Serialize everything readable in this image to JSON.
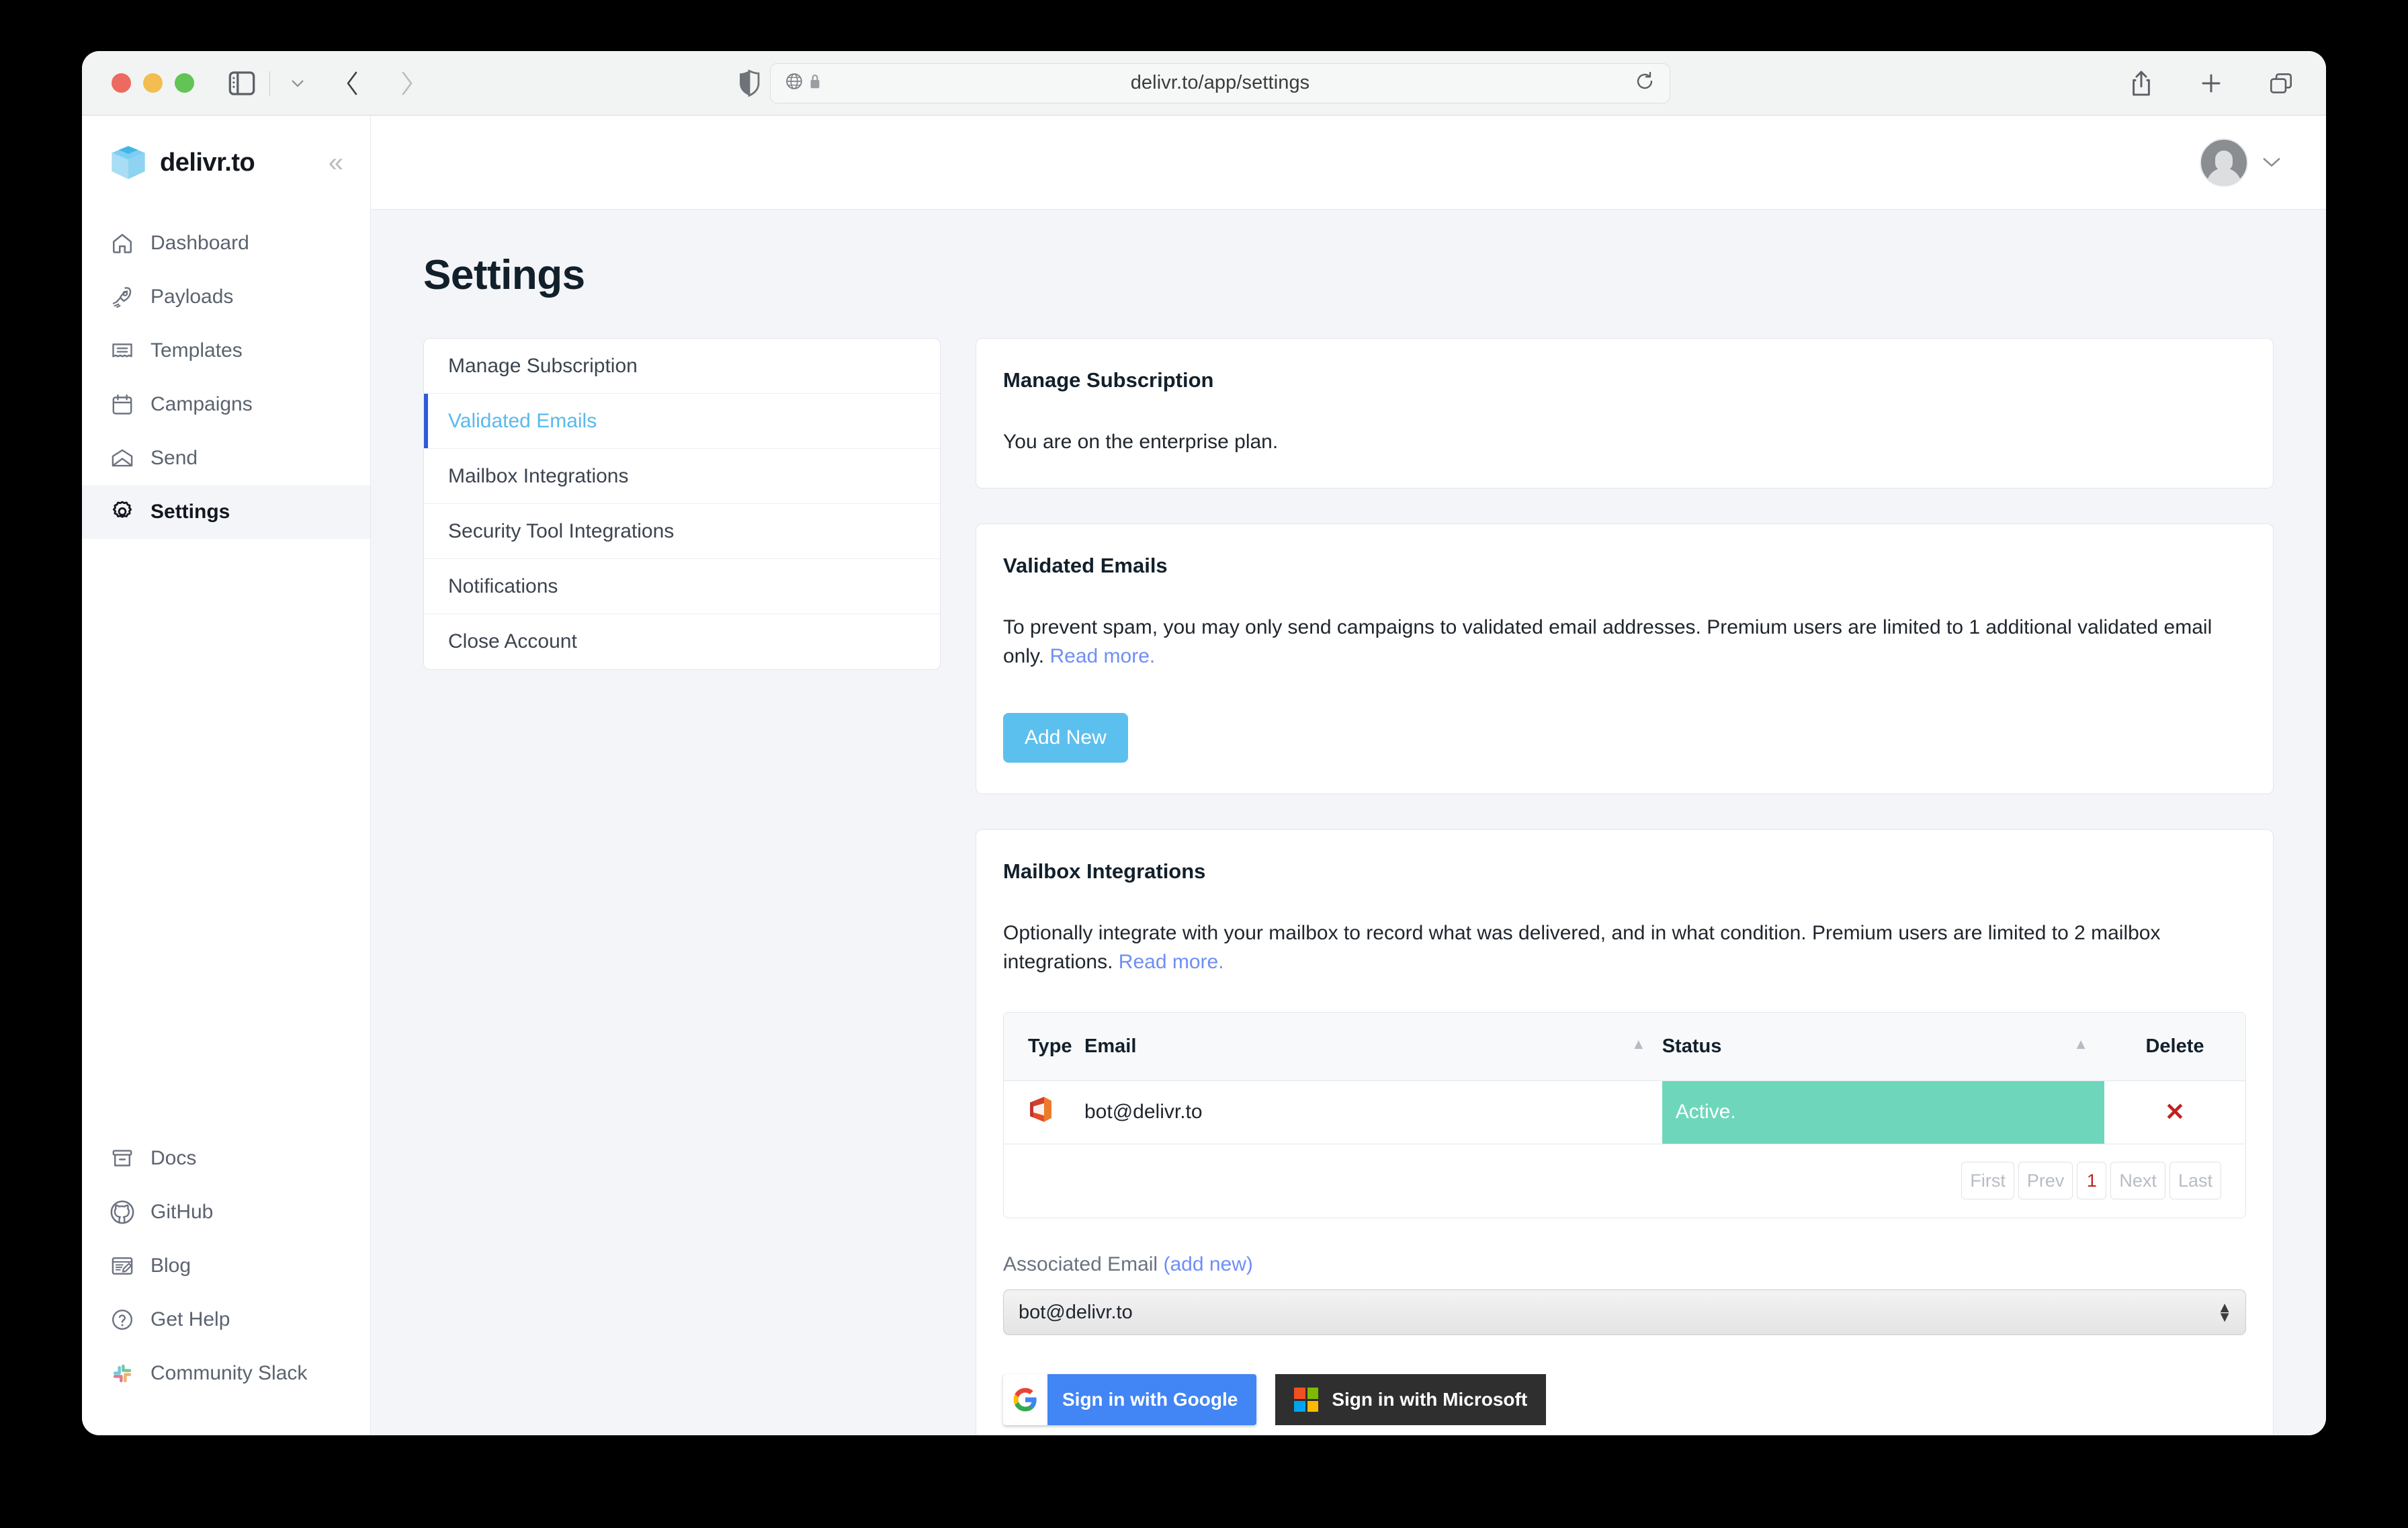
{
  "browser": {
    "url": "delivr.to/app/settings",
    "icons": {
      "sidebar_toggle": "sidebar-toggle-icon",
      "chevron_down": "chevron-down-icon",
      "back": "back-arrow-icon",
      "forward": "forward-arrow-icon",
      "shield": "shield-icon",
      "globe": "globe-icon",
      "lock": "lock-icon",
      "reload": "reload-icon",
      "share": "share-icon",
      "new_tab": "plus-icon",
      "tab_overview": "tab-overview-icon"
    }
  },
  "sidebar": {
    "brand": "delivr.to",
    "collapse_label": "«",
    "items": [
      {
        "label": "Dashboard",
        "icon": "home-icon",
        "active": false
      },
      {
        "label": "Payloads",
        "icon": "rocket-icon",
        "active": false
      },
      {
        "label": "Templates",
        "icon": "template-icon",
        "active": false
      },
      {
        "label": "Campaigns",
        "icon": "calendar-icon",
        "active": false
      },
      {
        "label": "Send",
        "icon": "envelope-icon",
        "active": false
      },
      {
        "label": "Settings",
        "icon": "gear-icon",
        "active": true
      }
    ],
    "bottom_items": [
      {
        "label": "Docs",
        "icon": "archive-icon"
      },
      {
        "label": "GitHub",
        "icon": "github-icon"
      },
      {
        "label": "Blog",
        "icon": "blog-icon"
      },
      {
        "label": "Get Help",
        "icon": "question-circle-icon"
      },
      {
        "label": "Community Slack",
        "icon": "slack-icon"
      }
    ]
  },
  "topbar": {
    "avatar": "avatar",
    "caret": "chevron-down-icon"
  },
  "page": {
    "title": "Settings"
  },
  "tablist": [
    {
      "label": "Manage Subscription",
      "active": false
    },
    {
      "label": "Validated Emails",
      "active": true
    },
    {
      "label": "Mailbox Integrations",
      "active": false
    },
    {
      "label": "Security Tool Integrations",
      "active": false
    },
    {
      "label": "Notifications",
      "active": false
    },
    {
      "label": "Close Account",
      "active": false
    }
  ],
  "cards": {
    "subscription": {
      "title": "Manage Subscription",
      "body": "You are on the enterprise plan."
    },
    "validated_emails": {
      "title": "Validated Emails",
      "body": "To prevent spam, you may only send campaigns to validated email addresses. Premium users are limited to 1 additional validated email only.",
      "link": "Read more.",
      "button": "Add New"
    },
    "mailbox_integrations": {
      "title": "Mailbox Integrations",
      "body": "Optionally integrate with your mailbox to record what was delivered, and in what condition. Premium users are limited to 2 mailbox integrations.",
      "link": "Read more.",
      "table": {
        "columns": [
          "Type",
          "Email",
          "Status",
          "Delete"
        ],
        "rows": [
          {
            "type_icon": "office365-icon",
            "email": "bot@delivr.to",
            "status": "Active.",
            "delete": "✕"
          }
        ]
      },
      "pagination": {
        "first": "First",
        "prev": "Prev",
        "current": "1",
        "next": "Next",
        "last": "Last"
      },
      "associated_email": {
        "label": "Associated Email",
        "add_new": "(add new)",
        "selected": "bot@delivr.to"
      },
      "oauth": {
        "google": "Sign in with Google",
        "microsoft": "Sign in with Microsoft"
      }
    }
  },
  "colors": {
    "accent_blue": "#5cc0ef",
    "active_tab_blue": "#5ab9ea",
    "active_tab_bar": "#2f5bd8",
    "link_blue": "#6f8ef5",
    "status_green": "#6ed7bb",
    "delete_red": "#c0211f",
    "page_bg": "#f4f5f8"
  }
}
